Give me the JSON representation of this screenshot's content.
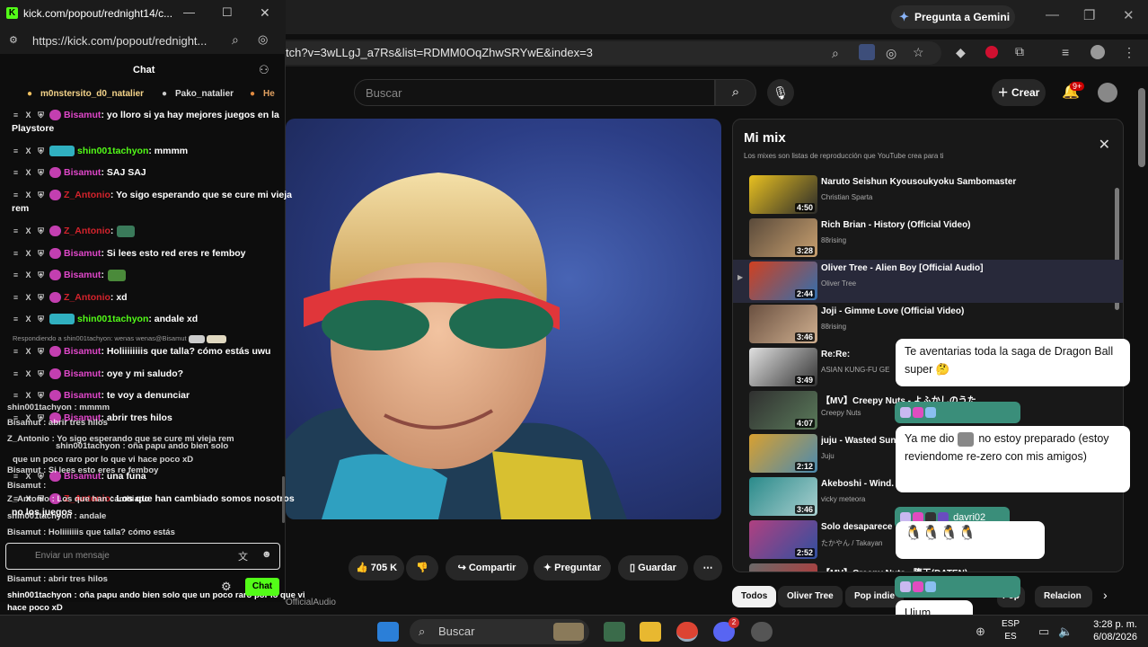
{
  "browser": {
    "gemini_button": "Pregunta a Gemini",
    "url": "tch?v=3wLLgJ_a7Rs&list=RDMM0OqZhwSRYwE&index=3"
  },
  "youtube": {
    "search_placeholder": "Buscar",
    "create_label": "Crear",
    "notif_count": "9+",
    "actions": {
      "likes": "705 K",
      "share": "Compartir",
      "ask": "Preguntar",
      "save": "Guardar"
    },
    "channel_attribution": "OfficialAudio",
    "mix": {
      "title": "Mi mix",
      "subtitle": "Los mixes son listas de reproducción que YouTube crea para ti",
      "items": [
        {
          "title": "Naruto Seishun Kyousoukyoku Sambomaster",
          "artist": "Christian Sparta",
          "duration": "4:50"
        },
        {
          "title": "Rich Brian - History (Official Video)",
          "artist": "88rising",
          "duration": "3:28"
        },
        {
          "title": "Oliver Tree - Alien Boy [Official Audio]",
          "artist": "Oliver Tree",
          "duration": "2:44"
        },
        {
          "title": "Joji - Gimme Love (Official Video)",
          "artist": "88rising",
          "duration": "3:46"
        },
        {
          "title": "Re:Re:",
          "artist": "ASIAN KUNG-FU GE",
          "duration": "3:49"
        },
        {
          "title": "【MV】Creepy Nuts - よふかしのうた",
          "artist": "Creepy Nuts",
          "duration": "4:07"
        },
        {
          "title": "juju - Wasted Sun",
          "artist": "Juju",
          "duration": "2:12"
        },
        {
          "title": "Akeboshi - Wind.",
          "artist": "vicky meteora",
          "duration": "3:46"
        },
        {
          "title": "Solo desaparece",
          "artist": "たかやん / Takayan",
          "duration": "2:52"
        },
        {
          "title": "【MV】Creepy Nuts - 堕天(DATEN)",
          "artist": "",
          "duration": ""
        }
      ]
    },
    "chips": [
      "Todos",
      "Oliver Tree",
      "Pop indie",
      "Pop",
      "Relacion"
    ]
  },
  "overlay": {
    "bubble1": "Te aventarias toda la saga de Dragon Ball super",
    "bubble2_a": "Ya me dio",
    "bubble2_b": "no estoy preparado (estoy reviendome re-zero con mis amigos)",
    "name3": "davri02",
    "bubble4": "Ujum"
  },
  "popout": {
    "window_title": "kick.com/popout/rednight14/c...",
    "url": "https://kick.com/popout/rednight...",
    "chat_title": "Chat",
    "gifters": [
      "m0nstersito_d0_natalier",
      "Pako_natalier",
      "He"
    ],
    "messages": [
      {
        "user": "Bisamut",
        "text": ": yo lloro si ya hay mejores juegos en la",
        "cont": "Playstore"
      },
      {
        "user": "shin001tachyon",
        "text": ": mmmm"
      },
      {
        "user": "Bisamut",
        "text": ": SAJ SAJ"
      },
      {
        "user": "Z_Antonio",
        "text": ": Yo sigo esperando que se cure mi vieja",
        "cont": "rem"
      },
      {
        "user": "Z_Antonio",
        "text": ":"
      },
      {
        "user": "Bisamut",
        "text": ": Si lees esto red eres re femboy"
      },
      {
        "user": "Bisamut",
        "text": ":"
      },
      {
        "user": "Z_Antonio",
        "text": ": xd"
      },
      {
        "user": "shin001tachyon",
        "text": ": andale xd"
      },
      {
        "user": "Bisamut",
        "text": ": Holiiiiiiiis que talla? cómo estás uwu"
      },
      {
        "user": "Bisamut",
        "text": ": oye y mi saludo?"
      },
      {
        "user": "Bisamut",
        "text": ": te voy a denunciar"
      },
      {
        "user": "Bisamut",
        "text": ": abrir tres hilos"
      },
      {
        "user": "Bisamut",
        "text": ": una funa"
      },
      {
        "user": "Z_Antonio",
        "text": ": Los que han cambiado somos nosotros",
        "cont": "no los juegos"
      }
    ],
    "reply_note": "Respondiendo a shin001tachyon: wenas wenas@Bisamut",
    "ghost_lines": [
      "shin001tachyon : mmmm",
      "Bisamut : abrir tres hilos",
      "Z_Antonio : Yo sigo esperando que se cure mi vieja rem",
      "shin001tachyon : oña papu ando bien solo",
      "que un poco raro por lo que vi hace poco xD",
      "Bisamut : Si lees esto eres re femboy",
      "Bisamut :",
      "Z_Antonio : Los que han cambiado",
      "shin001tachyon : andale",
      "Bisamut : Holiiiiiiis que talla? cómo estás",
      "Bisamut : oye y mi saludo?",
      "Bisamut : te voy a denunciar",
      "Bisamut : abrir tres hilos",
      "shin001tachyon : oña papu ando bien solo que un poco raro por lo que vi",
      "hace poco xD",
      "Bisamut : una funa",
      "Z_Antonio : Los que han cambiado somos nosotros no los juegos"
    ],
    "input_placeholder": "Enviar un mensaje",
    "send_label": "Chat"
  },
  "taskbar": {
    "search": "Buscar",
    "lang_top": "ESP",
    "lang_bottom": "ES",
    "time": "3:28 p. m.",
    "date": "6/08/2026",
    "discord_badge": "2"
  }
}
